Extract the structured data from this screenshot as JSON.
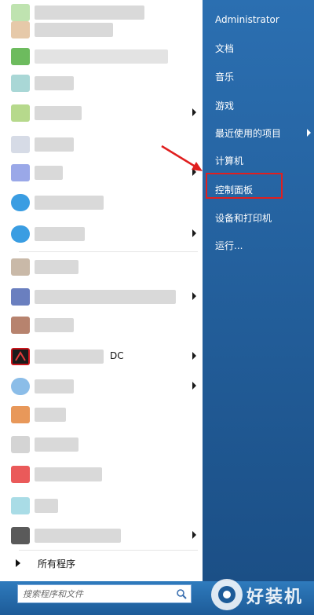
{
  "user": {
    "name": "Administrator"
  },
  "right_menu": [
    {
      "id": "documents",
      "label": "文档",
      "arrow": false
    },
    {
      "id": "music",
      "label": "音乐",
      "arrow": false
    },
    {
      "id": "games",
      "label": "游戏",
      "arrow": false
    },
    {
      "id": "recent",
      "label": "最近使用的项目",
      "arrow": true
    },
    {
      "id": "computer",
      "label": "计算机",
      "arrow": false
    },
    {
      "id": "control-panel",
      "label": "控制面板",
      "arrow": false
    },
    {
      "id": "devices",
      "label": "设备和打印机",
      "arrow": false
    },
    {
      "id": "run",
      "label": "运行...",
      "arrow": false
    }
  ],
  "left_menu": {
    "visible_fragment": "DC",
    "all_programs": "所有程序"
  },
  "search": {
    "placeholder": "搜索程序和文件"
  },
  "watermark": {
    "text": "好装机"
  },
  "colors": {
    "highlight": "#e01f1f",
    "right_pane": "#2b6fb1"
  }
}
